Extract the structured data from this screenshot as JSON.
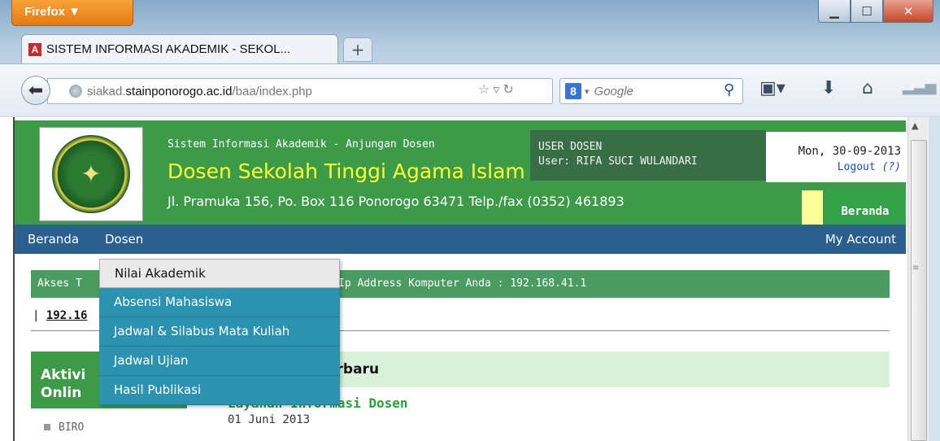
{
  "browser": {
    "menu_button": "Firefox ▼",
    "tab_title": "SISTEM INFORMASI AKADEMIK - SEKOL...",
    "tab_favicon": "A",
    "new_tab": "+",
    "url_prefix": "siakad.",
    "url_domain": "stainponorogo.ac.id",
    "url_path": "/baa/index.php",
    "search_engine_icon": "8",
    "search_placeholder": "Google",
    "icons": [
      "back-arrow-icon",
      "globe-icon",
      "star-icon",
      "reload-icon",
      "search-icon",
      "bookmarks-icon",
      "download-icon",
      "home-icon"
    ]
  },
  "header": {
    "subtitle": "Sistem Informasi Akademik - Anjungan Dosen",
    "title": "Dosen Sekolah Tinggi Agama Islam",
    "address": "Jl. Pramuka 156, Po. Box 116 Ponorogo 63471 Telp./fax (0352) 461893",
    "user_role": "USER DOSEN",
    "user_name": "User: RIFA SUCI WULANDARI",
    "date": "Mon, 30-09-2013",
    "logout": "Logout",
    "logout_help": "(?)",
    "beranda_button": "Beranda"
  },
  "menu": {
    "beranda": "Beranda",
    "dosen": "Dosen",
    "my_account": "My Account",
    "dropdown": [
      "Nilai Akademik",
      "Absensi Mahasiswa",
      "Jadwal & Silabus Mata Kuliah",
      "Jadwal Ujian",
      "Hasil Publikasi"
    ]
  },
  "content": {
    "akses_label": "Akses T",
    "ip_text": "Ip Address Komputer Anda : 192.168.41.1",
    "ip_link_prefix": "| ",
    "ip_link": "192.16",
    "aktivitas_line1": "Aktivi",
    "aktivitas_line2": "Onlin",
    "biro": "BIRO",
    "berita_title": "erbaru",
    "berita_link": "Layanan Informasi Dosen",
    "berita_date": "01 Juni 2013"
  },
  "colors": {
    "header_green": "#3c9a49",
    "menu_blue": "#2a5f8e",
    "dropdown_teal": "#2d91b0",
    "title_yellow": "#ffff33"
  }
}
